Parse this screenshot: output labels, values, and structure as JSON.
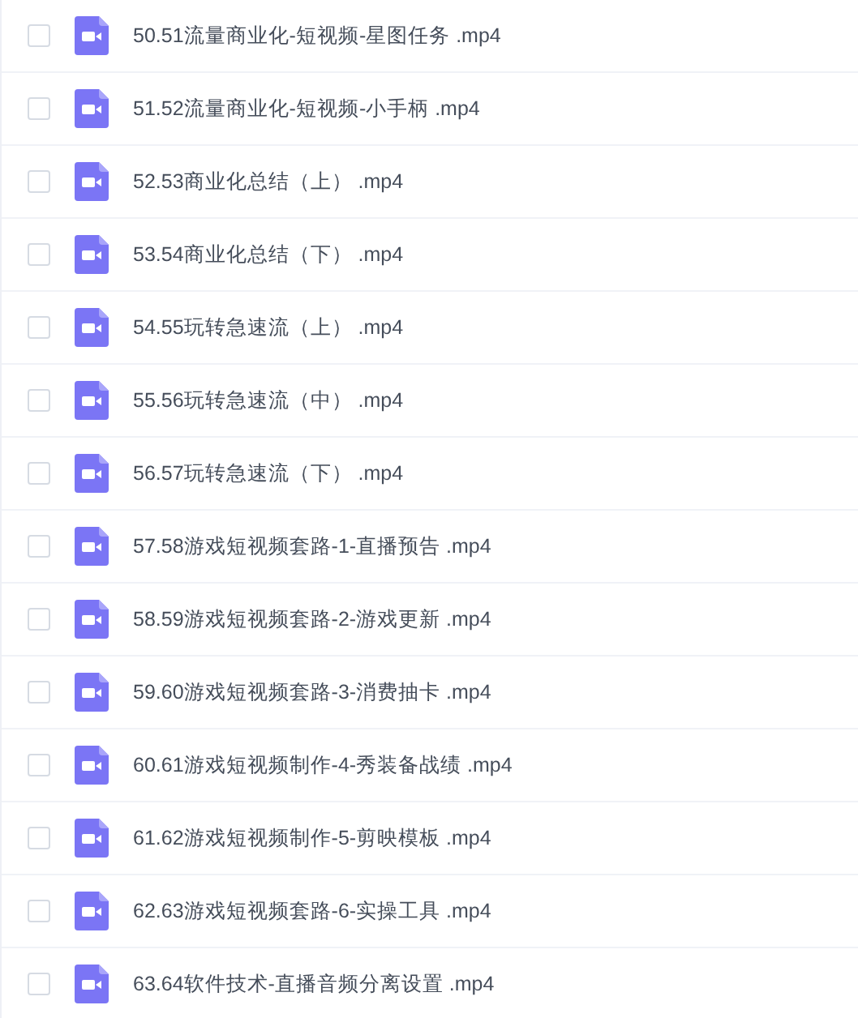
{
  "files": [
    {
      "name": "50.51流量商业化-短视频-星图任务 .mp4",
      "checked": false
    },
    {
      "name": "51.52流量商业化-短视频-小手柄 .mp4",
      "checked": false
    },
    {
      "name": "52.53商业化总结（上） .mp4",
      "checked": false
    },
    {
      "name": "53.54商业化总结（下） .mp4",
      "checked": false
    },
    {
      "name": "54.55玩转急速流（上） .mp4",
      "checked": false
    },
    {
      "name": "55.56玩转急速流（中） .mp4",
      "checked": false
    },
    {
      "name": "56.57玩转急速流（下） .mp4",
      "checked": false
    },
    {
      "name": "57.58游戏短视频套路-1-直播预告 .mp4",
      "checked": false
    },
    {
      "name": "58.59游戏短视频套路-2-游戏更新 .mp4",
      "checked": false
    },
    {
      "name": "59.60游戏短视频套路-3-消费抽卡 .mp4",
      "checked": false
    },
    {
      "name": "60.61游戏短视频制作-4-秀装备战绩 .mp4",
      "checked": false
    },
    {
      "name": "61.62游戏短视频制作-5-剪映模板 .mp4",
      "checked": false
    },
    {
      "name": "62.63游戏短视频套路-6-实操工具 .mp4",
      "checked": false
    },
    {
      "name": "63.64软件技术-直播音频分离设置 .mp4",
      "checked": false
    }
  ]
}
